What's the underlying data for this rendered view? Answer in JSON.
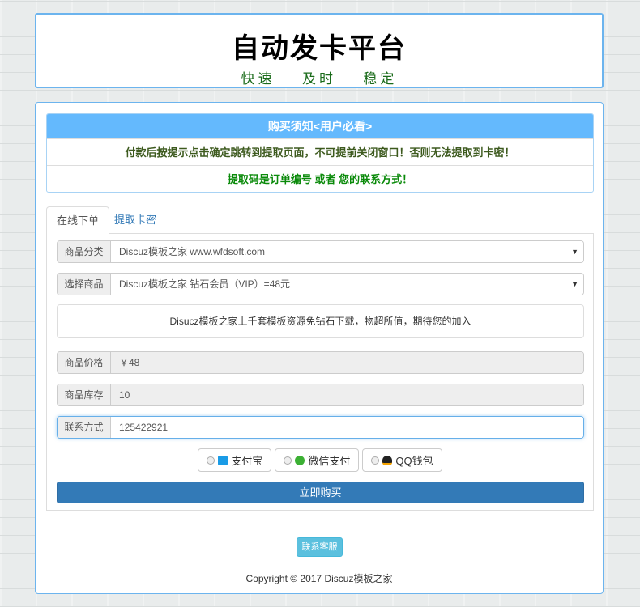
{
  "header": {
    "title": "自动发卡平台",
    "slogan": "快速 及时 稳定"
  },
  "notice": {
    "title": "购买须知<用户必看>",
    "line1": "付款后按提示点击确定跳转到提取页面，不可提前关闭窗口！否则无法提取到卡密！",
    "line2": "提取码是订单编号 或者 您的联系方式！",
    "colors": {
      "line1": "#3d5a1e",
      "line2": "#0a8a0a"
    }
  },
  "tabs": [
    {
      "label": "在线下单"
    },
    {
      "label": "提取卡密"
    }
  ],
  "form": {
    "category": {
      "label": "商品分类",
      "value": "Discuz模板之家 www.wfdsoft.com"
    },
    "product": {
      "label": "选择商品",
      "value": "Discuz模板之家 钻石会员（VIP）=48元"
    },
    "description": "Disucz模板之家上千套模板资源免钻石下载，物超所值，期待您的加入",
    "price": {
      "label": "商品价格",
      "value": "￥48"
    },
    "stock": {
      "label": "商品库存",
      "value": "10"
    },
    "contact": {
      "label": "联系方式",
      "value": "125422921"
    }
  },
  "payments": [
    {
      "label": "支付宝",
      "icon": "alipay-icon"
    },
    {
      "label": "微信支付",
      "icon": "wechat-icon"
    },
    {
      "label": "QQ钱包",
      "icon": "qq-icon"
    }
  ],
  "buy_label": "立即购买",
  "service_label": "联系客服",
  "copyright": "Copyright © 2017 Discuz模板之家"
}
